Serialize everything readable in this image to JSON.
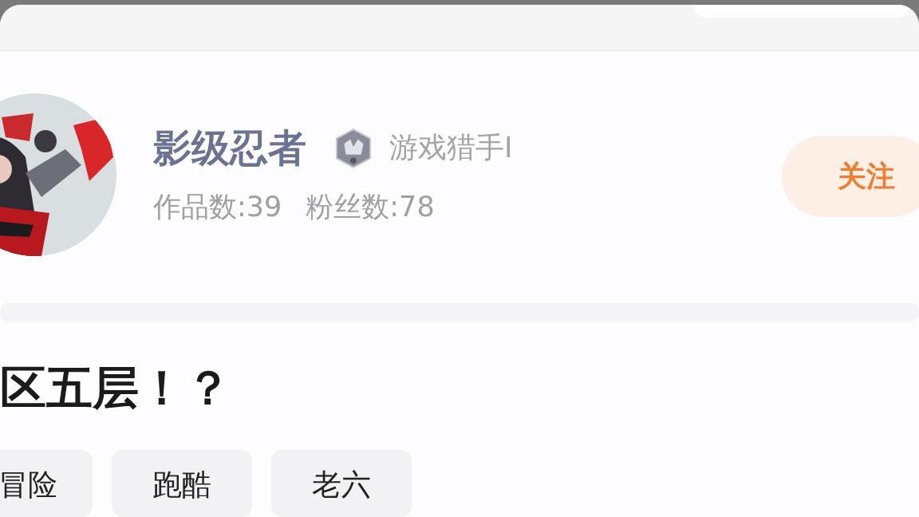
{
  "profile": {
    "avatar": {
      "kind": "picture"
    },
    "name": "影级忍者",
    "title": "游戏猎手I",
    "stats": [
      "作品数:39",
      "粉丝数:78"
    ],
    "follow_button": "关注"
  },
  "post": {
    "title": "区五层！？",
    "tags": [
      "冒险",
      "跑酷",
      "老六"
    ]
  }
}
